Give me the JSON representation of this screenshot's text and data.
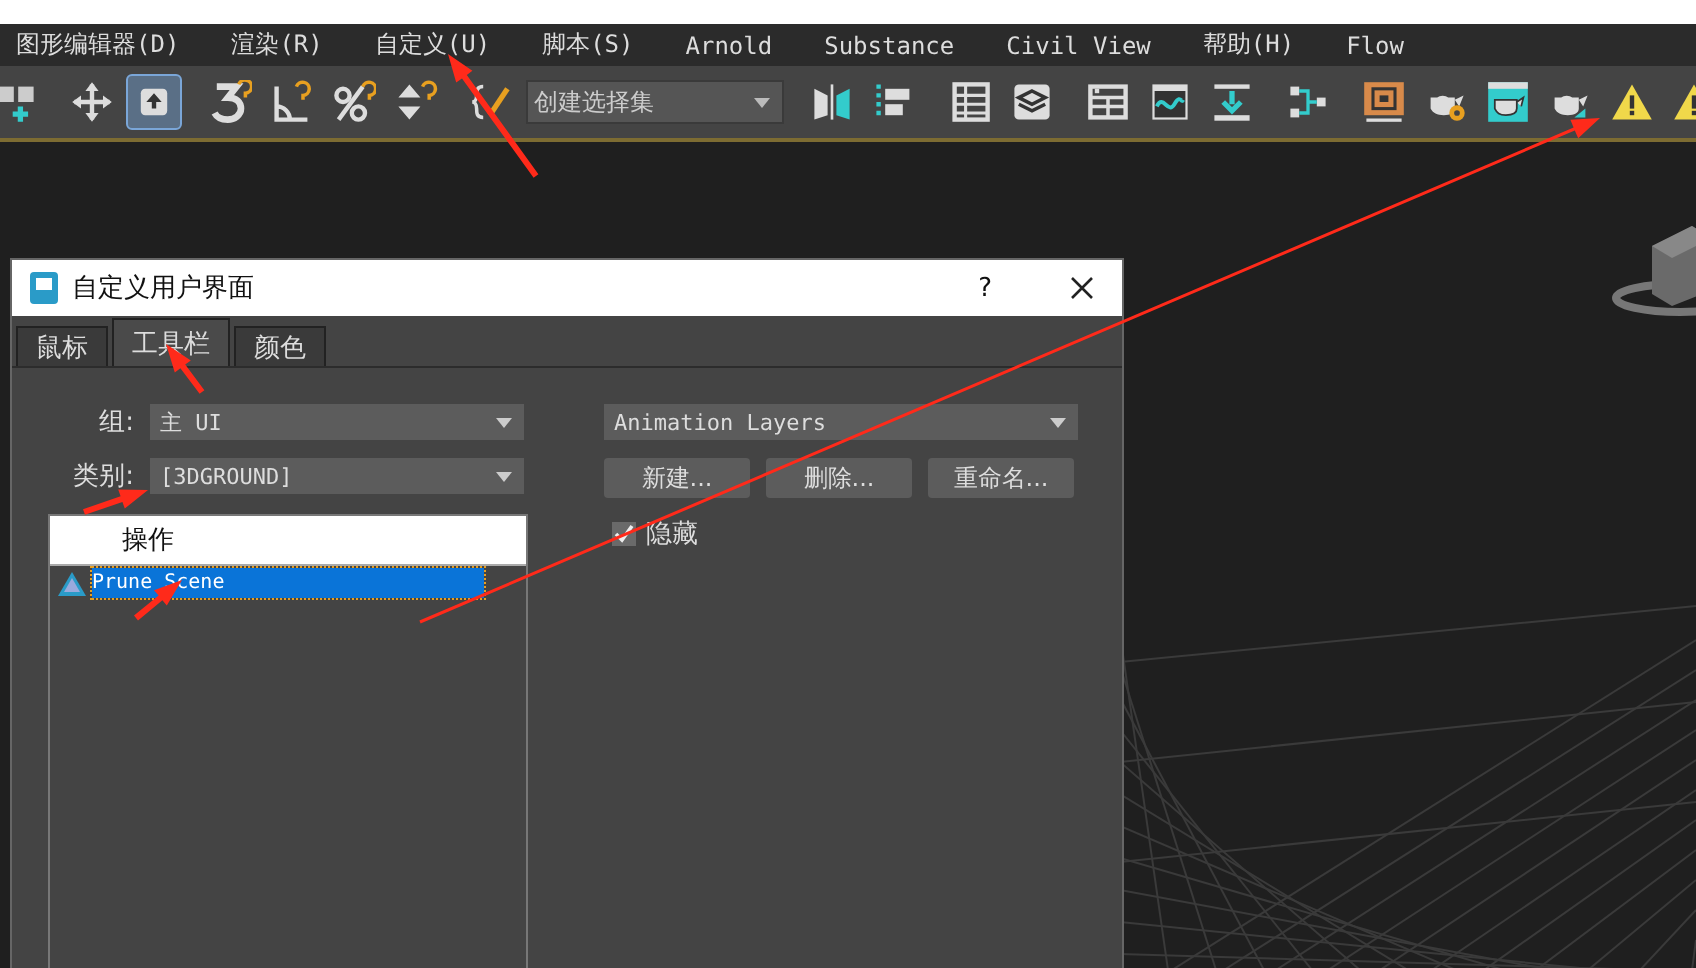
{
  "menu": [
    {
      "label": "图形编辑器(D)"
    },
    {
      "label": "渲染(R)"
    },
    {
      "label": "自定义(U)"
    },
    {
      "label": "脚本(S)"
    },
    {
      "label": "Arnold"
    },
    {
      "label": "Substance"
    },
    {
      "label": "Civil View"
    },
    {
      "label": "帮助(H)"
    },
    {
      "label": "Flow"
    }
  ],
  "toolbar": [
    {
      "kind": "add",
      "selected": false
    },
    {
      "kind": "sep"
    },
    {
      "kind": "move",
      "selected": false
    },
    {
      "kind": "select",
      "selected": true
    },
    {
      "kind": "sep"
    },
    {
      "kind": "snap",
      "selected": false
    },
    {
      "kind": "angle",
      "selected": false
    },
    {
      "kind": "percent",
      "selected": false
    },
    {
      "kind": "spinner",
      "selected": false
    },
    {
      "kind": "sep"
    },
    {
      "kind": "pencil",
      "selected": false
    },
    {
      "kind": "dropdown",
      "value": "创建选择集"
    },
    {
      "kind": "sep"
    },
    {
      "kind": "mirror",
      "selected": false
    },
    {
      "kind": "align",
      "selected": false
    },
    {
      "kind": "sep"
    },
    {
      "kind": "list",
      "selected": false
    },
    {
      "kind": "layers",
      "selected": false
    },
    {
      "kind": "sep"
    },
    {
      "kind": "panel",
      "selected": false
    },
    {
      "kind": "curve",
      "selected": false
    },
    {
      "kind": "download",
      "selected": false
    },
    {
      "kind": "sep"
    },
    {
      "kind": "nodes",
      "selected": false
    },
    {
      "kind": "sep"
    },
    {
      "kind": "material",
      "selected": false
    },
    {
      "kind": "teapot_gear",
      "selected": false
    },
    {
      "kind": "teapot_window",
      "selected": false
    },
    {
      "kind": "teapot",
      "selected": false
    },
    {
      "kind": "warning",
      "selected": false
    },
    {
      "kind": "warning",
      "selected": false
    }
  ],
  "dialog": {
    "title": "自定义用户界面",
    "help": "?",
    "tabs": [
      {
        "label": "鼠标",
        "selected": false
      },
      {
        "label": "工具栏",
        "selected": true
      },
      {
        "label": "颜色",
        "selected": false
      }
    ],
    "group": {
      "label": "组:",
      "value": "主 UI"
    },
    "category": {
      "label": "类别:",
      "value": "[3DGROUND]"
    },
    "actions": {
      "header": "操作",
      "rows": [
        {
          "label": "Prune Scene",
          "selected": true
        }
      ]
    },
    "toolbar_select": {
      "value": "Animation Layers"
    },
    "buttons": [
      {
        "label": "新建..."
      },
      {
        "label": "删除..."
      },
      {
        "label": "重命名..."
      }
    ],
    "hide": {
      "label": "隐藏",
      "checked": true
    }
  }
}
